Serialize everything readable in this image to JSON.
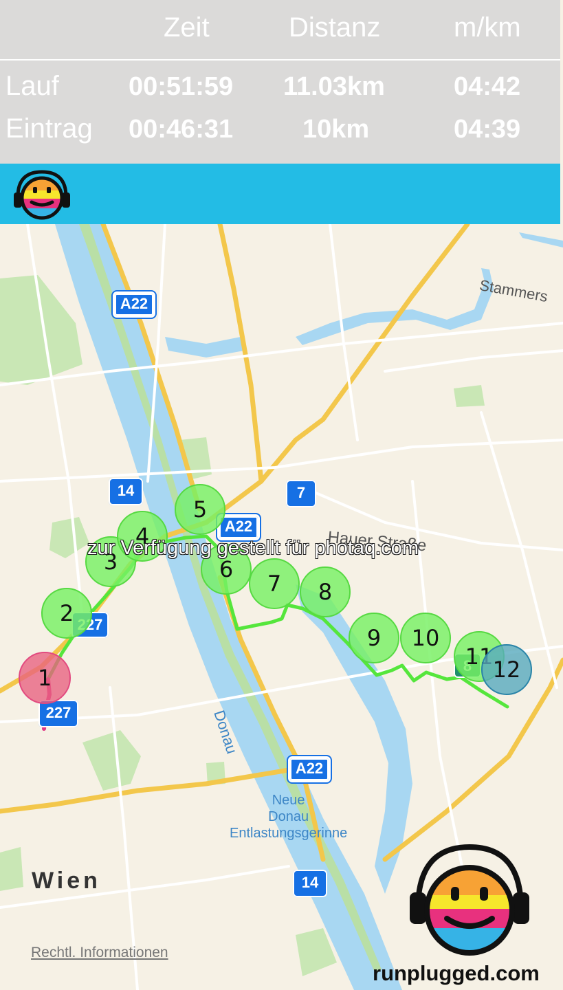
{
  "stats": {
    "headers": [
      "Zeit",
      "Distanz",
      "m/km"
    ],
    "rows": [
      {
        "label": "Lauf",
        "time": "00:51:59",
        "distance": "11.03km",
        "pace": "04:42"
      },
      {
        "label": "Eintrag",
        "time": "00:46:31",
        "distance": "10km",
        "pace": "04:39"
      }
    ]
  },
  "colors": {
    "header_bar": "#23bce5",
    "route": "#55e63c",
    "start_segment": "#e03a86",
    "marker_fill": "#78f064",
    "start_marker": "#e86080",
    "end_marker": "#58aabe"
  },
  "map": {
    "road_shields": [
      "A22",
      "A22",
      "A22",
      "14",
      "14",
      "7",
      "227",
      "227",
      "8"
    ],
    "labels": {
      "stammers": "Stammers",
      "hauer": "Hauer Straße",
      "donau": "Donau",
      "neue_donau_1": "Neue",
      "neue_donau_2": "Donau",
      "entlastung": "Entlastungsgerinne",
      "city": "Wien",
      "legal": "Rechtl. Informationen"
    }
  },
  "route": {
    "markers": [
      "1",
      "2",
      "3",
      "4",
      "5",
      "6",
      "7",
      "8",
      "9",
      "10",
      "11",
      "12"
    ]
  },
  "watermark": "zur Verfügung gestellt für photaq.com",
  "brand": "runplugged.com"
}
